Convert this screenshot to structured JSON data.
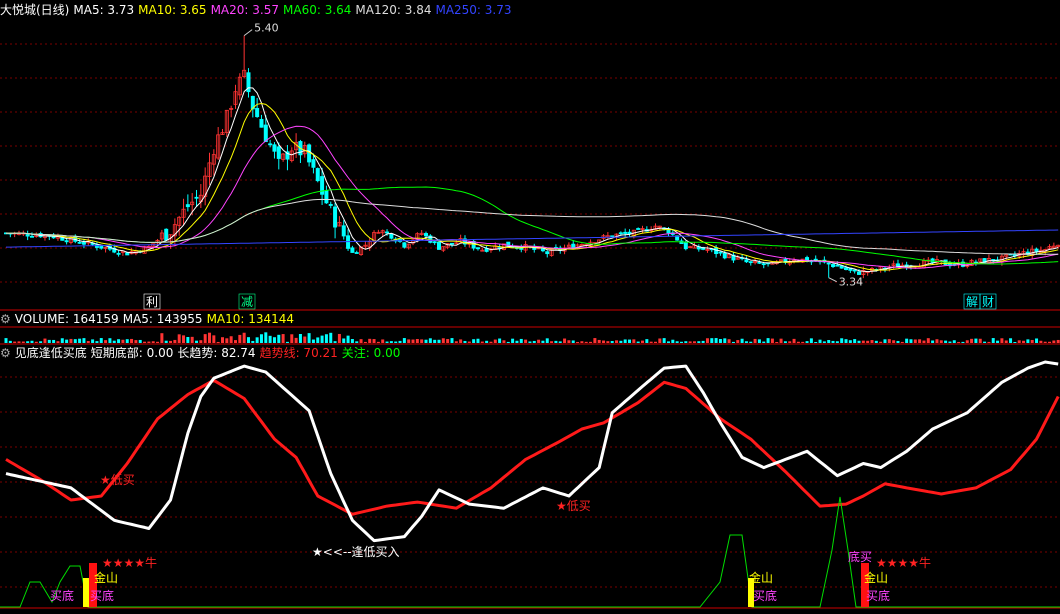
{
  "main": {
    "title": "大悦城(日线)",
    "ma": [
      {
        "label": "MA5: 3.73",
        "color": "#ffffff"
      },
      {
        "label": "MA10: 3.65",
        "color": "#ffff00"
      },
      {
        "label": "MA20: 3.57",
        "color": "#ff44ff"
      },
      {
        "label": "MA60: 3.64",
        "color": "#00ff00"
      },
      {
        "label": "MA120: 3.84",
        "color": "#dddddd"
      },
      {
        "label": "MA250: 3.73",
        "color": "#3344ff"
      }
    ],
    "high_label": "5.40",
    "low_label": "3.34",
    "markers": [
      {
        "text": "利",
        "color": "#ffffff"
      },
      {
        "text": "减",
        "color": "#00ff88"
      },
      {
        "text": "解",
        "color": "#00ffff"
      },
      {
        "text": "财",
        "color": "#00ffff"
      }
    ]
  },
  "volume": {
    "legend": [
      {
        "label": "VOLUME: 164159",
        "color": "#ffffff"
      },
      {
        "label": "MA5: 143955",
        "color": "#ffffff"
      },
      {
        "label": "MA10: 134144",
        "color": "#ffff00"
      }
    ]
  },
  "indicator": {
    "name": "见底逢低买底",
    "legend": [
      {
        "label": "短期底部: 0.00",
        "color": "#ffffff"
      },
      {
        "label": "长趋势: 82.74",
        "color": "#ffffff"
      },
      {
        "label": "趋势线: 70.21",
        "color": "#ff2222"
      },
      {
        "label": "关注: 0.00",
        "color": "#00ff00"
      }
    ],
    "annotations": {
      "low_buy": "低买",
      "dip_buy": "<<--逢低买入",
      "stars_bull": "★★★牛",
      "gold_mountain": "金山",
      "buy_bottom": "买底",
      "bottom_buy": "底买"
    }
  },
  "colors": {
    "up": "#ff3333",
    "down": "#00ffff",
    "grid": "#7a0000",
    "separator": "#cc0000"
  }
}
